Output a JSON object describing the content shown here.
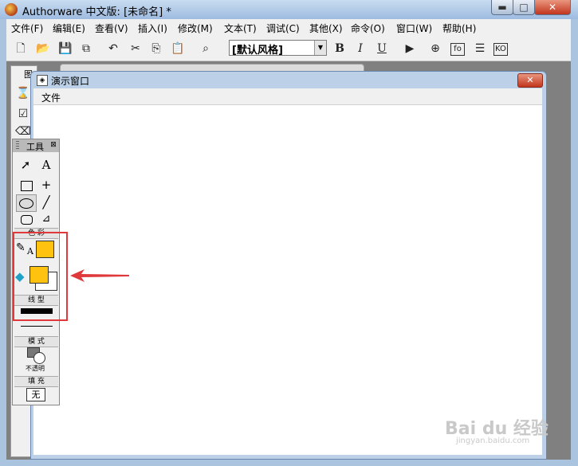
{
  "window": {
    "title": "Authorware 中文版: [未命名] *",
    "min_glyph": "▬",
    "max_glyph": "□",
    "close_glyph": "✕"
  },
  "menu": [
    "文件(F)",
    "编辑(E)",
    "查看(V)",
    "插入(I)",
    "修改(M)",
    "文本(T)",
    "调试(C)",
    "其他(X)",
    "命令(O)",
    "窗口(W)",
    "帮助(H)"
  ],
  "toolbar": {
    "style_select": "[默认风格]",
    "bold": "B",
    "italic": "I",
    "underline": "U",
    "fo_label": "fo",
    "ko_label": "KO"
  },
  "presentation_window": {
    "title": "演示窗口",
    "menu_file": "文件",
    "close_glyph": "✕"
  },
  "left_panel": {
    "title_glyph": "图"
  },
  "tools_palette": {
    "title": "工具",
    "close_glyph": "⊠",
    "text_tool": "A",
    "color_label": "色 彩",
    "color_text_letter": "A",
    "line_label": "线 型",
    "mode_label": "模 式",
    "mode_value": "不透明",
    "fill_label": "填 充",
    "fill_value": "无",
    "colors": {
      "line": "#ffc20e",
      "fill_fg": "#ffc20e",
      "fill_bg": "#ffffff"
    }
  },
  "annotation": {
    "color": "#e0393b"
  },
  "watermark": {
    "brand": "Bai du 经验",
    "url": "jingyan.baidu.com"
  }
}
